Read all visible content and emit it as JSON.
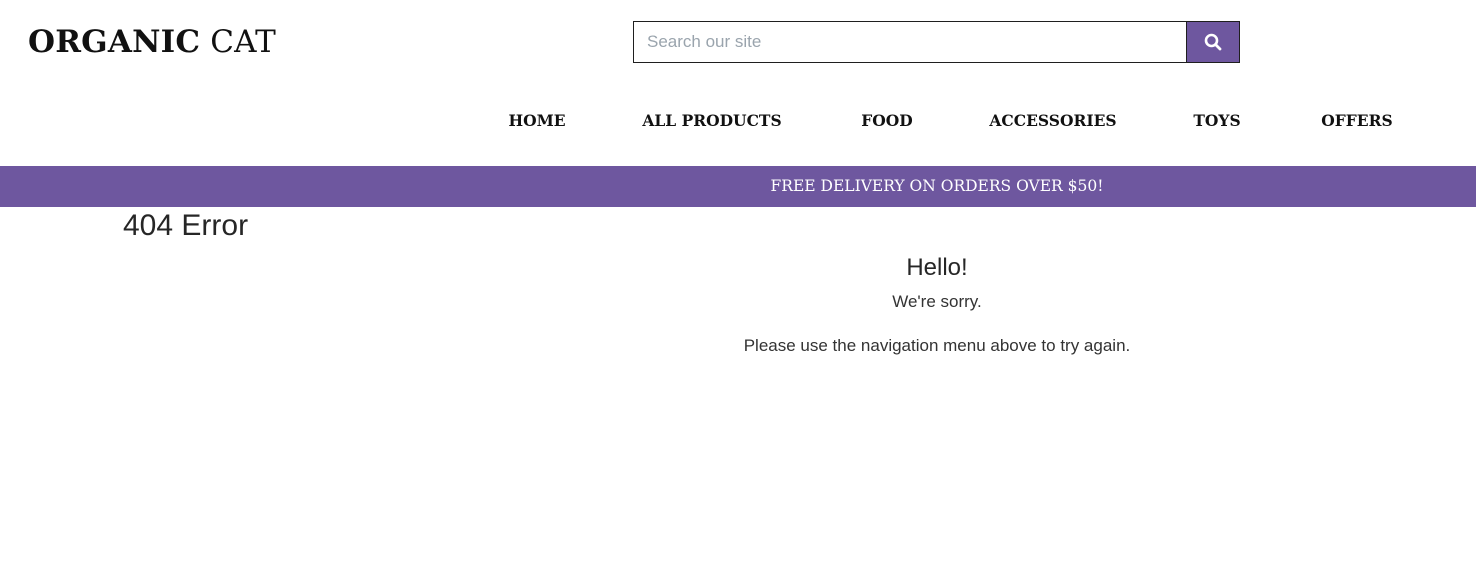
{
  "header": {
    "logo_bold": "ORGANIC",
    "logo_light": "CAT"
  },
  "search": {
    "placeholder": "Search our site",
    "value": "",
    "button_icon": "search-icon"
  },
  "nav": {
    "items": [
      {
        "label": "HOME"
      },
      {
        "label": "ALL PRODUCTS"
      },
      {
        "label": "FOOD"
      },
      {
        "label": "ACCESSORIES"
      },
      {
        "label": "TOYS"
      },
      {
        "label": "OFFERS"
      }
    ]
  },
  "promo": {
    "text": "FREE DELIVERY ON ORDERS OVER $50!"
  },
  "main": {
    "title": "404 Error",
    "heading": "Hello!",
    "line1": "We're sorry.",
    "line2": "Please use the navigation menu above to try again."
  },
  "colors": {
    "brand_purple": "#6e579f",
    "text_dark": "#111111",
    "white": "#ffffff"
  }
}
